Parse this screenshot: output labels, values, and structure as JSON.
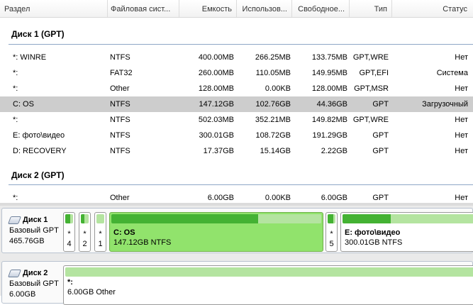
{
  "header": {
    "col_name": "Раздел",
    "col_fs": "Файловая сист...",
    "col_cap": "Емкость",
    "col_used": "Использов...",
    "col_free": "Свободное...",
    "col_type": "Тип",
    "col_status": "Статус"
  },
  "groups": {
    "g1": {
      "title": "Диск 1 (GPT)"
    },
    "g2": {
      "title": "Диск 2 (GPT)"
    }
  },
  "rows": [
    {
      "name": "*: WINRE",
      "fs": "NTFS",
      "cap": "400.00MB",
      "used": "266.25MB",
      "free": "133.75MB",
      "type": "GPT,WRE",
      "status": "Нет"
    },
    {
      "name": "*:",
      "fs": "FAT32",
      "cap": "260.00MB",
      "used": "110.05MB",
      "free": "149.95MB",
      "type": "GPT,EFI",
      "status": "Система"
    },
    {
      "name": "*:",
      "fs": "Other",
      "cap": "128.00MB",
      "used": "0.00KB",
      "free": "128.00MB",
      "type": "GPT,MSR",
      "status": "Нет"
    },
    {
      "name": "C: OS",
      "fs": "NTFS",
      "cap": "147.12GB",
      "used": "102.76GB",
      "free": "44.36GB",
      "type": "GPT",
      "status": "Загрузочный"
    },
    {
      "name": "*:",
      "fs": "NTFS",
      "cap": "502.03MB",
      "used": "352.21MB",
      "free": "149.82MB",
      "type": "GPT,WRE",
      "status": "Нет"
    },
    {
      "name": "E: фото\\видео",
      "fs": "NTFS",
      "cap": "300.01GB",
      "used": "108.72GB",
      "free": "191.29GB",
      "type": "GPT",
      "status": "Нет"
    },
    {
      "name": "D: RECOVERY",
      "fs": "NTFS",
      "cap": "17.37GB",
      "used": "15.14GB",
      "free": "2.22GB",
      "type": "GPT",
      "status": "Нет"
    },
    {
      "name": "*:",
      "fs": "Other",
      "cap": "6.00GB",
      "used": "0.00KB",
      "free": "6.00GB",
      "type": "GPT",
      "status": "Нет"
    }
  ],
  "disks": {
    "d1": {
      "name": "Диск 1",
      "type": "Базовый GPT",
      "size": "465.76GB",
      "small1": {
        "a": "*",
        "b": "4"
      },
      "small2": {
        "a": "*",
        "b": "2"
      },
      "small3": {
        "a": "*",
        "b": "1"
      },
      "c_label": "C: OS",
      "c_info": "147.12GB NTFS",
      "c_fill_percent": 69.8,
      "small5": {
        "a": "*",
        "b": "5"
      },
      "e_label": "E: фото\\видео",
      "e_info": "300.01GB NTFS",
      "e_fill_percent": 36.2
    },
    "d2": {
      "name": "Диск 2",
      "type": "Базовый GPT",
      "size": "6.00GB",
      "p_label": "*:",
      "p_info": "6.00GB Other",
      "p_fill_percent": 0
    }
  },
  "colors": {
    "selected_row": "#cdcdcd",
    "partition_selected": "#91e36c",
    "usage_fill": "#44b233",
    "usage_bar": "#b4e4a0",
    "group_line": "#8ea6c6"
  }
}
